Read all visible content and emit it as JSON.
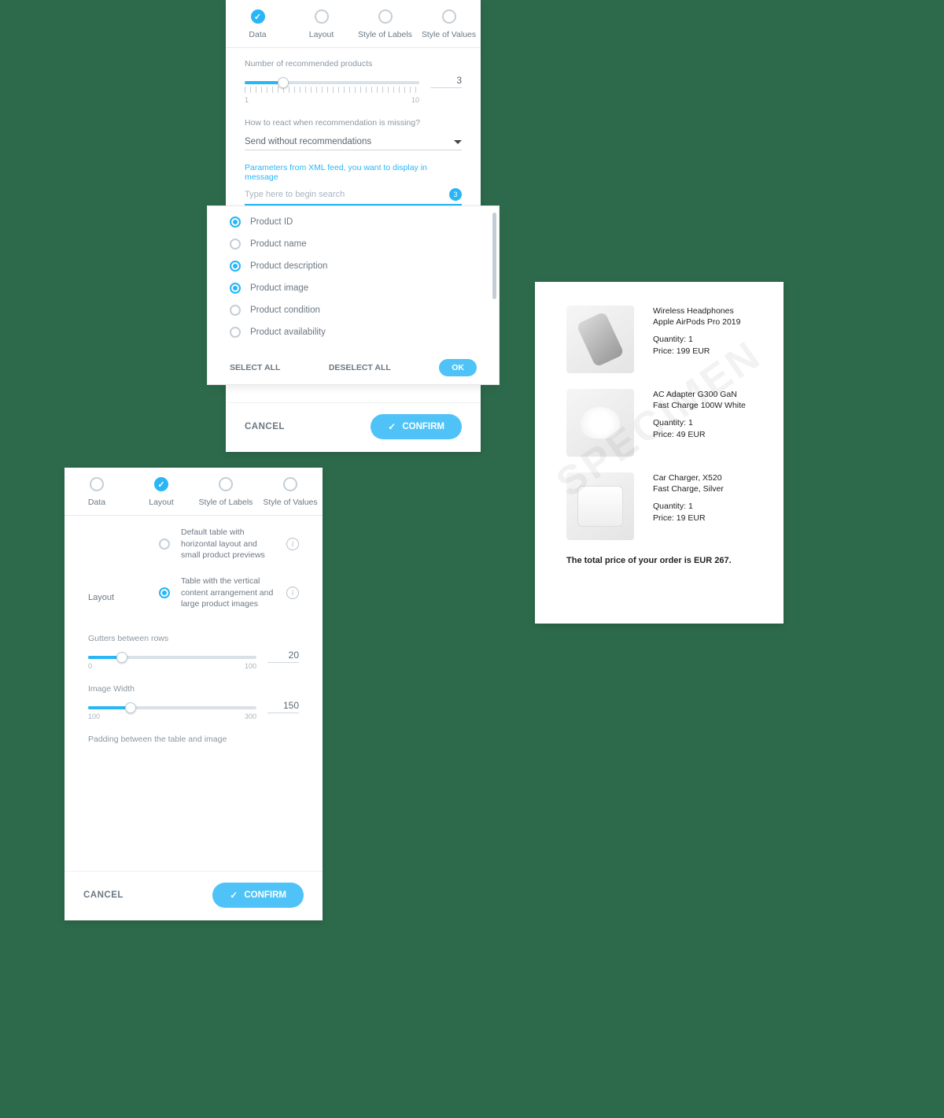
{
  "panelA": {
    "tabs": [
      "Data",
      "Layout",
      "Style of Labels",
      "Style of Values"
    ],
    "activeTab": 0,
    "numRecLabel": "Number of recommended products",
    "numRecValue": "3",
    "numRecMin": "1",
    "numRecMax": "10",
    "missingLabel": "How to react when recommendation is missing?",
    "missingValue": "Send without recommendations",
    "paramsHeader": "Parameters from XML feed, you want to display in message",
    "searchPlaceholder": "Type here to begin search",
    "badgeCount": "3",
    "params": [
      {
        "label": "Product ID",
        "selected": true
      },
      {
        "label": "Product name",
        "selected": false
      },
      {
        "label": "Product description",
        "selected": true
      },
      {
        "label": "Product image",
        "selected": true
      },
      {
        "label": "Product condition",
        "selected": false
      },
      {
        "label": "Product availability",
        "selected": false
      }
    ],
    "selectAll": "SELECT ALL",
    "deselectAll": "DESELECT ALL",
    "ok": "OK",
    "cancel": "CANCEL",
    "confirm": "CONFIRM"
  },
  "panelB": {
    "tabs": [
      "Data",
      "Layout",
      "Style of Labels",
      "Style of Values"
    ],
    "activeTab": 1,
    "layoutTitle": "Layout",
    "opt1": "Default table with horizontal layout and small product previews",
    "opt2": "Table with the vertical content arrangement and large product images",
    "selectedOpt": 1,
    "guttersLabel": "Gutters between rows",
    "guttersValue": "20",
    "guttersMin": "0",
    "guttersMax": "100",
    "widthLabel": "Image Width",
    "widthValue": "150",
    "widthMin": "100",
    "widthMax": "300",
    "paddingLabel": "Padding between the table and image",
    "cancel": "CANCEL",
    "confirm": "CONFIRM"
  },
  "panelC": {
    "watermark": "SPECIMEN",
    "products": [
      {
        "line1": "Wireless Headphones",
        "line2": "Apple AirPods Pro 2019",
        "qty": "Quantity: 1",
        "price": "Price: 199 EUR"
      },
      {
        "line1": "AC Adapter G300 GaN",
        "line2": "Fast Charge 100W White",
        "qty": "Quantity: 1",
        "price": "Price: 49 EUR"
      },
      {
        "line1": "Car Charger, X520",
        "line2": "Fast Charge, Silver",
        "qty": "Quantity: 1",
        "price": "Price: 19 EUR"
      }
    ],
    "total": "The total price of your order is EUR 267."
  }
}
